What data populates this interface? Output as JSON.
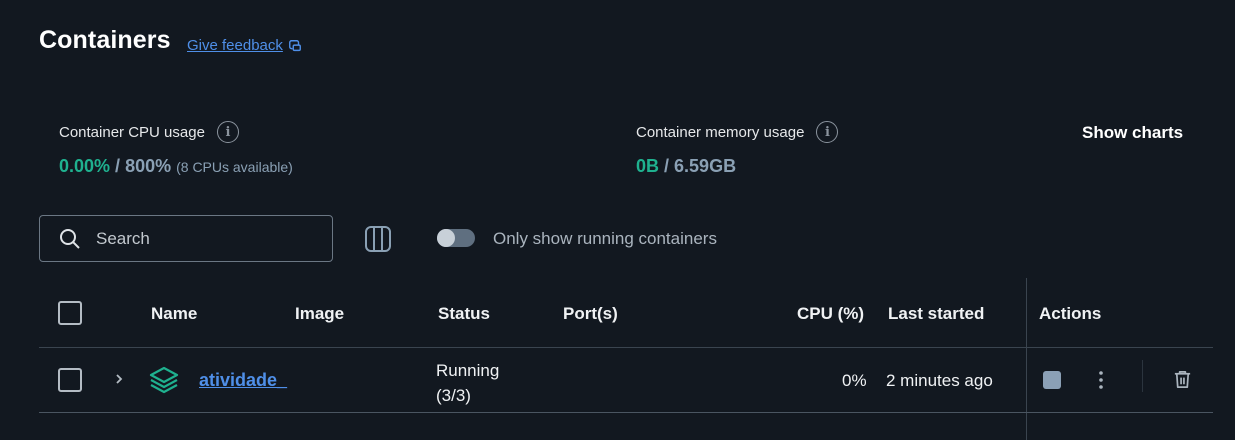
{
  "header": {
    "title": "Containers",
    "feedback_label": "Give feedback"
  },
  "stats": {
    "cpu": {
      "label": "Container CPU usage",
      "used": "0.00%",
      "separator": "/",
      "total": "800%",
      "note": "(8 CPUs available)"
    },
    "memory": {
      "label": "Container memory usage",
      "used": "0B",
      "separator": "/",
      "total": "6.59GB"
    },
    "show_charts_label": "Show charts"
  },
  "toolbar": {
    "search_placeholder": "Search",
    "toggle_label": "Only show running containers",
    "toggle_on": false
  },
  "table": {
    "headers": {
      "name": "Name",
      "image": "Image",
      "status": "Status",
      "ports": "Port(s)",
      "cpu": "CPU (%)",
      "last_started": "Last started",
      "actions": "Actions"
    },
    "rows": [
      {
        "name": "atividade_",
        "image": "",
        "status_line1": "Running",
        "status_line2": "(3/3)",
        "ports": "",
        "cpu": "0%",
        "last_started": "2 minutes ago"
      }
    ]
  },
  "icons": {
    "feedback": "external-feedback-icon",
    "info": "info-icon",
    "search": "search-icon",
    "columns": "columns-icon",
    "expand": "chevron-right-icon",
    "container_stack": "stack-icon",
    "stop": "stop-icon",
    "more": "kebab-menu-icon",
    "delete": "trash-icon"
  },
  "colors": {
    "background": "#121820",
    "accent_green": "#1fb18f",
    "link_blue": "#4f8fe8"
  }
}
